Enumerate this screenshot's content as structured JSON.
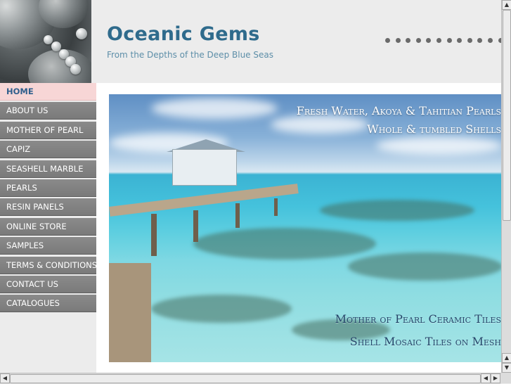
{
  "header": {
    "title": "Oceanic Gems",
    "tagline": "From the Depths of the Deep Blue Seas"
  },
  "nav": {
    "items": [
      {
        "label": "HOME",
        "active": true
      },
      {
        "label": "ABOUT US"
      },
      {
        "label": "MOTHER OF PEARL"
      },
      {
        "label": "CAPIZ"
      },
      {
        "label": "SEASHELL MARBLE"
      },
      {
        "label": "PEARLS"
      },
      {
        "label": "RESIN PANELS"
      },
      {
        "label": "ONLINE STORE"
      },
      {
        "label": "SAMPLES"
      },
      {
        "label": "TERMS & CONDITIONS"
      },
      {
        "label": "CONTACT US"
      },
      {
        "label": "CATALOGUES"
      }
    ]
  },
  "hero": {
    "line1": "Fresh Water, Akoya & Tahitian Pearls",
    "line2": "Whole & tumbled Shells",
    "line3": "Mother of Pearl Ceramic Tiles",
    "line4": "Shell Mosaic Tiles on Mesh"
  },
  "colors": {
    "title": "#2f6b8c",
    "tagline": "#5d8ea8",
    "nav_bg": "#808080",
    "nav_active_bg": "#f7d6d6",
    "nav_active_text": "#2f5f8c"
  },
  "scrollbars": {
    "up_arrow": "▲",
    "down_arrow": "▼",
    "left_arrow": "◀",
    "right_arrow": "▶"
  }
}
